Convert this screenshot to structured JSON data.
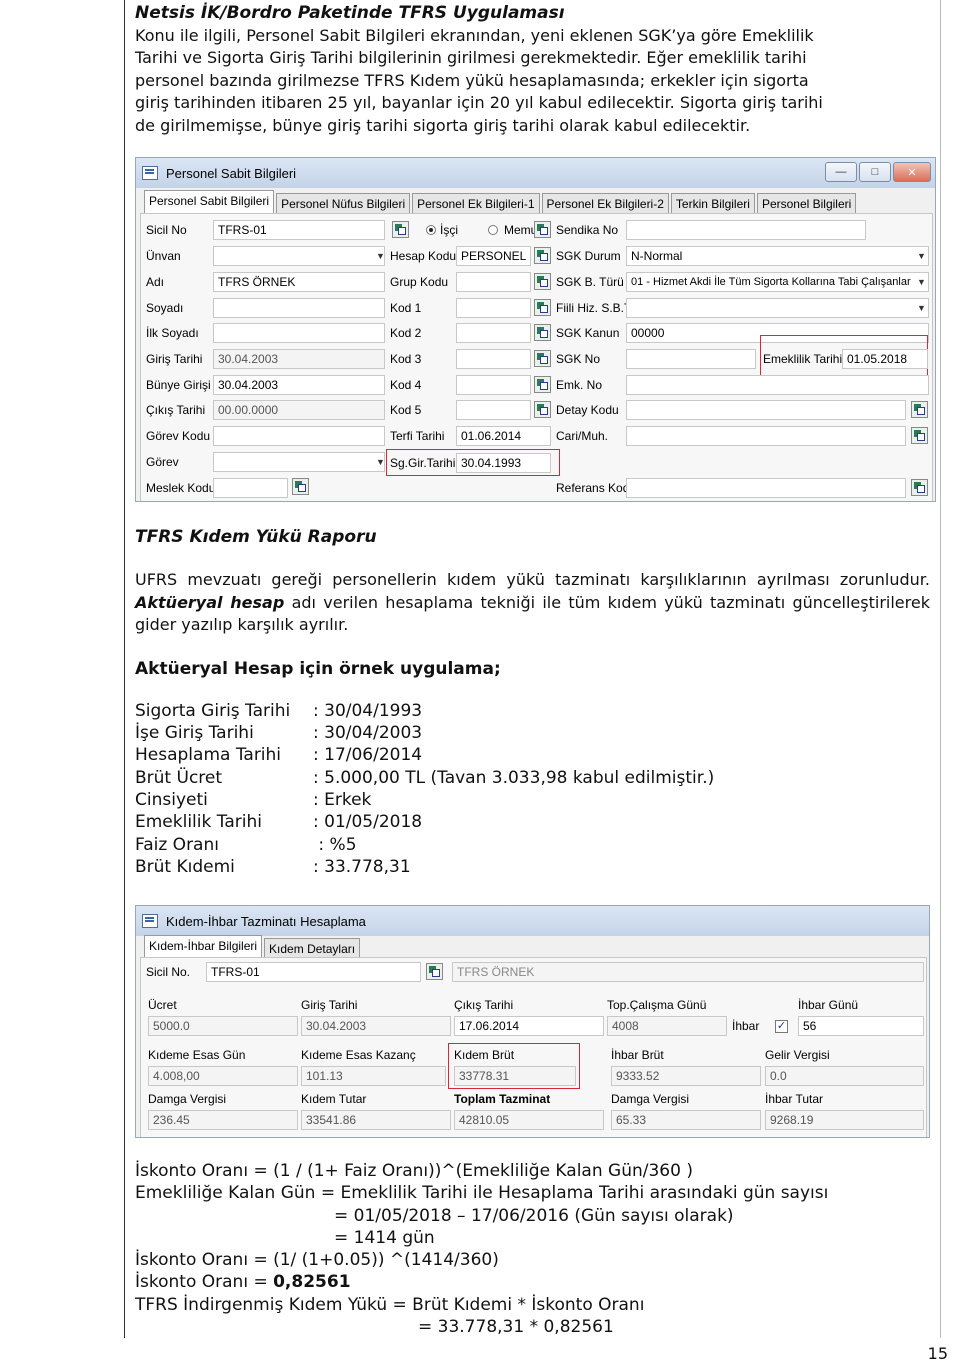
{
  "intro": {
    "title": "Netsis İK/Bordro Paketinde TFRS Uygulaması",
    "lines": [
      "Konu ile ilgili, Personel Sabit Bilgileri ekranından, yeni eklenen SGK’ya göre Emeklilik",
      "Tarihi ve Sigorta Giriş Tarihi bilgilerinin girilmesi gerekmektedir. Eğer emeklilik tarihi",
      "personel bazında girilmezse TFRS Kıdem yükü hesaplamasında; erkekler için sigorta",
      "giriş tarihinden itibaren 25 yıl, bayanlar için 20 yıl kabul edilecektir. Sigorta giriş tarihi",
      "de girilmemişse, bünye giriş tarihi sigorta giriş tarihi olarak kabul edilecektir."
    ]
  },
  "win1": {
    "title": "Personel Sabit Bilgileri",
    "tabs": [
      "Personel Sabit Bilgileri",
      "Personel Nüfus Bilgileri",
      "Personel Ek Bilgileri-1",
      "Personel Ek Bilgileri-2",
      "Terkin Bilgileri",
      "Personel Bilgileri"
    ],
    "col1": {
      "labels": [
        "Sicil No",
        "Ünvan",
        "Adı",
        "Soyadı",
        "İlk Soyadı",
        "Giriş Tarihi",
        "Bünye Girişi",
        "Çıkış Tarihi",
        "Görev Kodu",
        "Görev",
        "Meslek Kodu"
      ],
      "values": [
        "TFRS-01",
        "",
        "TFRS ÖRNEK",
        "",
        "",
        "30.04.2003",
        "30.04.2003",
        "00.00.0000",
        "",
        "",
        ""
      ]
    },
    "radio": {
      "isci": "İşçi",
      "memur": "Memur"
    },
    "col2": {
      "labels": [
        "Hesap Kodu",
        "Grup Kodu",
        "Kod 1",
        "Kod 2",
        "Kod 3",
        "Kod 4",
        "Kod 5",
        "Terfi Tarihi",
        "Sg.Gir.Tarihi"
      ],
      "values": [
        "PERSONEL",
        "",
        "",
        "",
        "",
        "",
        "",
        "01.06.2014",
        "30.04.1993"
      ]
    },
    "col3": {
      "labels": [
        "Sendika No",
        "SGK Durum",
        "SGK B. Türü",
        "Fiili Hiz. S.B.T",
        "SGK Kanun",
        "SGK No",
        "Emk. No",
        "Detay Kodu",
        "Cari/Muh.",
        "Referans Kodu"
      ],
      "values": [
        "",
        "N-Normal",
        "01 - Hizmet Akdi İle Tüm Sigorta Kollarına Tabi Çalışanlar",
        "",
        "00000",
        "",
        "",
        "",
        "",
        ""
      ]
    },
    "emeklilik": {
      "label": "Emeklilik Tarihi",
      "value": "01.05.2018"
    }
  },
  "report": {
    "title": "TFRS Kıdem Yükü Raporu",
    "p1": "UFRS mevzuatı gereği personellerin kıdem yükü tazminatı karşılıklarının ayrılması zorunludur.",
    "p1_bold": "Aktüeryal hesap",
    "p1_rest": "adı verilen hesaplama tekniği ile tüm kıdem yükü tazminatı güncelleştirilerek gider yazılıp karşılık ayrılır.",
    "example_title": "Aktüeryal Hesap için örnek uygulama;",
    "rows": [
      {
        "k": "Sigorta Giriş Tarihi",
        "v": ": 30/04/1993"
      },
      {
        "k": "İşe Giriş Tarihi",
        "v": ": 30/04/2003"
      },
      {
        "k": "Hesaplama Tarihi",
        "v": ": 17/06/2014"
      },
      {
        "k": "Brüt Ücret",
        "v": ": 5.000,00 TL (Tavan 3.033,98 kabul edilmiştir.)"
      },
      {
        "k": "Cinsiyeti",
        "v": ":  Erkek"
      },
      {
        "k": "Emeklilik Tarihi",
        "v": ": 01/05/2018"
      },
      {
        "k": "Faiz Oranı",
        "v": " : %5"
      },
      {
        "k": "Brüt Kıdemi",
        "v": ": 33.778,31"
      }
    ]
  },
  "win2": {
    "title": "Kıdem-İhbar Tazminatı Hesaplama",
    "tabs": [
      "Kıdem-İhbar Bilgileri",
      "Kıdem Detayları"
    ],
    "sicil_label": "Sicil No.",
    "sicil_value": "TFRS-01",
    "name_value": "TFRS ÖRNEK",
    "row1": [
      {
        "l": "Ücret",
        "v": "5000.0"
      },
      {
        "l": "Giriş Tarihi",
        "v": "30.04.2003"
      },
      {
        "l": "Çıkış Tarihi",
        "v": "17.06.2014"
      },
      {
        "l": "Top.Çalışma Günü",
        "v": "4008"
      },
      {
        "l": "İhbar Günü",
        "v": "56"
      }
    ],
    "ihbar_check": "İhbar",
    "row2": [
      {
        "l": "Kıdeme Esas Gün",
        "v": "4.008,00"
      },
      {
        "l": "Kıdeme Esas Kazanç",
        "v": "101.13"
      },
      {
        "l": "Kıdem Brüt",
        "v": "33778.31"
      },
      {
        "l": "İhbar Brüt",
        "v": "9333.52"
      },
      {
        "l": "Gelir Vergisi",
        "v": "0.0"
      }
    ],
    "row3": [
      {
        "l": "Damga Vergisi",
        "v": "236.45"
      },
      {
        "l": "Kıdem Tutar",
        "v": "33541.86"
      },
      {
        "l": "Toplam Tazminat",
        "v": "42810.05"
      },
      {
        "l": "Damga Vergisi",
        "v": "65.33"
      },
      {
        "l": "İhbar Tutar",
        "v": "9268.19"
      }
    ]
  },
  "formula": {
    "l1": "İskonto Oranı = (1 / (1+ Faiz Oranı))^(Emekliliğe Kalan Gün/360 )",
    "l2": "Emekliliğe Kalan Gün = Emeklilik Tarihi ile Hesaplama Tarihi arasındaki gün sayısı",
    "l3": "= 01/05/2018 – 17/06/2016 (Gün sayısı olarak)",
    "l4": "= 1414 gün",
    "l5": "İskonto Oranı = (1/ (1+0.05)) ^(1414/360)",
    "l6_prefix": "İskonto Oranı = ",
    "l6_bold": "0,82561",
    "l7": "TFRS İndirgenmiş Kıdem Yükü = Brüt Kıdemi * İskonto Oranı",
    "l8": "= 33.778,31 * 0,82561"
  },
  "page_number": "15"
}
